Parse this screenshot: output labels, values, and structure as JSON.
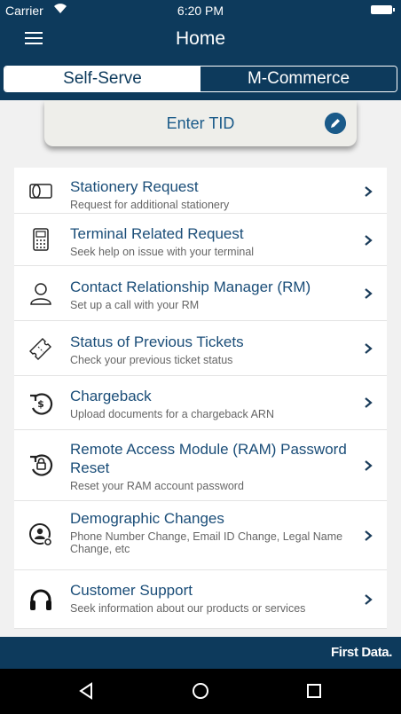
{
  "status_bar": {
    "carrier": "Carrier",
    "time": "6:20 PM"
  },
  "header": {
    "title": "Home"
  },
  "tabs": [
    {
      "label": "Self-Serve",
      "active": true
    },
    {
      "label": "M-Commerce",
      "active": false
    }
  ],
  "tid": {
    "label": "Enter TID"
  },
  "menu": [
    {
      "title": "Stationery Request",
      "subtitle": "Request for additional stationery",
      "icon": "stationery-icon"
    },
    {
      "title": "Terminal Related Request",
      "subtitle": "Seek help on issue with your terminal",
      "icon": "terminal-icon"
    },
    {
      "title": "Contact Relationship Manager (RM)",
      "subtitle": "Set up a call with your RM",
      "icon": "person-icon"
    },
    {
      "title": "Status of Previous Tickets",
      "subtitle": "Check your previous ticket status",
      "icon": "ticket-icon"
    },
    {
      "title": "Chargeback",
      "subtitle": "Upload documents for a chargeback ARN",
      "icon": "chargeback-icon"
    },
    {
      "title": "Remote Access Module (RAM) Password Reset",
      "subtitle": "Reset your RAM account password",
      "icon": "lock-reset-icon"
    },
    {
      "title": "Demographic Changes",
      "subtitle": "Phone Number Change, Email ID Change, Legal Name Change, etc",
      "icon": "user-settings-icon"
    },
    {
      "title": "Customer Support",
      "subtitle": "Seek information about our products or services",
      "icon": "headset-icon"
    }
  ],
  "footer": {
    "brand": "First Data."
  },
  "colors": {
    "primary": "#0d3a5c",
    "accent": "#1a5a89",
    "background": "#f1f1f1"
  }
}
